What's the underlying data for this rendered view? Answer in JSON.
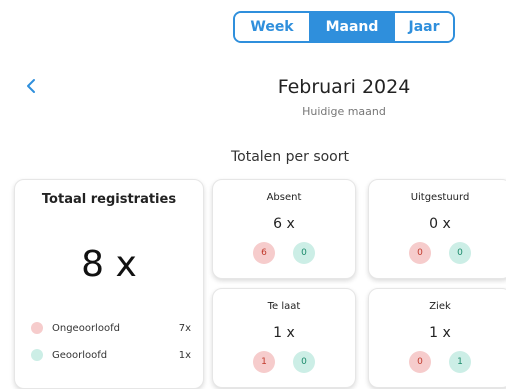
{
  "period_selector": {
    "week_label": "Week",
    "month_label": "Maand",
    "year_label": "Jaar",
    "selected": "Maand"
  },
  "header": {
    "back_icon": "chevron-left-icon",
    "title": "Februari 2024",
    "subtitle": "Huidige maand"
  },
  "section_title": "Totalen per soort",
  "colors": {
    "accent": "#2f8fdc",
    "unauthorized": "#f6cccc",
    "authorized": "#cceee6"
  },
  "total": {
    "title": "Totaal registraties",
    "value": "8 x",
    "legend": [
      {
        "label": "Ongeoorloofd",
        "count": "7x"
      },
      {
        "label": "Geoorloofd",
        "count": "1x"
      }
    ]
  },
  "categories": [
    {
      "title": "Absent",
      "value": "6 x",
      "unauthorized": "6",
      "authorized": "0"
    },
    {
      "title": "Uitgestuurd",
      "value": "0 x",
      "unauthorized": "0",
      "authorized": "0"
    },
    {
      "title": "Te laat",
      "value": "1 x",
      "unauthorized": "1",
      "authorized": "0"
    },
    {
      "title": "Ziek",
      "value": "1 x",
      "unauthorized": "0",
      "authorized": "1"
    }
  ]
}
